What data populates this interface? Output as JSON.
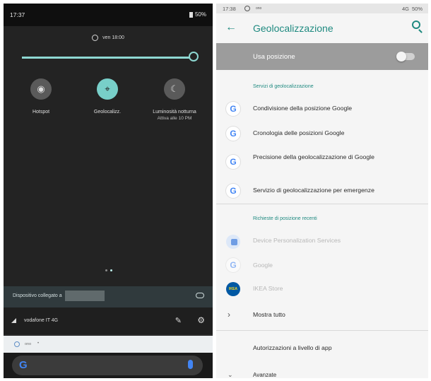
{
  "left_panel": {
    "status_bar": {
      "time": "17:37",
      "battery": "50%"
    },
    "alarm_label": "ven 18:00",
    "tiles": [
      {
        "label": "Hotspot",
        "icon": "hotspot-icon",
        "active": false
      },
      {
        "label": "Geolocalizz.",
        "icon": "location-pin-icon",
        "active": true
      },
      {
        "label": "Luminosità notturna",
        "sublabel": "Attiva alle 10 PM",
        "icon": "moon-icon",
        "active": false
      }
    ],
    "device_connected_label": "Dispositivo collegato a",
    "network_name": "vodafone IT 4G",
    "notification_icon_label": "ono"
  },
  "right_panel": {
    "status_bar": {
      "time": "17:38",
      "info": "ono",
      "signal": "4G",
      "battery": "50%"
    },
    "title": "Geolocalizzazione",
    "master_toggle": {
      "label": "Usa posizione",
      "checked": false
    },
    "section_services": "Servizi di geolocalizzazione",
    "services": [
      {
        "label": "Condivisione della posizione Google",
        "icon": "google-g-icon"
      },
      {
        "label": "Cronologia delle posizioni Google",
        "icon": "google-g-icon"
      },
      {
        "label": "Precisione della geolocalizzazione di Google",
        "icon": "google-g-icon"
      },
      {
        "label": "Servizio di geolocalizzazione per emergenze",
        "icon": "google-g-icon"
      }
    ],
    "section_recent": "Richieste di posizione recenti",
    "recent": [
      {
        "label": "Device Personalization Services",
        "icon": "device-personalization-icon"
      },
      {
        "label": "Google",
        "icon": "google-g-icon"
      },
      {
        "label": "IKEA Store",
        "icon": "ikea-icon"
      }
    ],
    "show_all": "Mostra tutto",
    "app_permissions": "Autorizzazioni a livello di app",
    "advanced": "Avanzate"
  },
  "colors": {
    "accent": "#1f8a80",
    "tile_active": "#78cfc9",
    "toggle_bar": "#9c9c9c"
  }
}
